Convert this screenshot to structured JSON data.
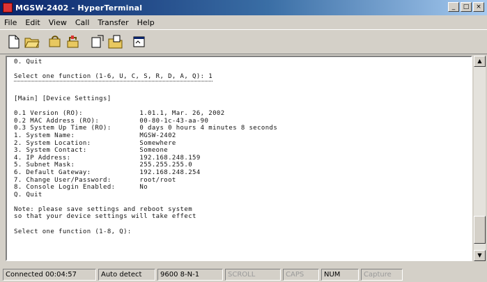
{
  "window": {
    "title": "MGSW-2402 - HyperTerminal"
  },
  "title_buttons": {
    "minimize": "_",
    "maximize": "□",
    "close": "×"
  },
  "menu": [
    "File",
    "Edit",
    "View",
    "Call",
    "Transfer",
    "Help"
  ],
  "toolbar": [
    "new-icon",
    "open-icon",
    "connect-icon",
    "disconnect-icon",
    "send-icon",
    "receive-icon",
    "properties-icon"
  ],
  "terminal": {
    "lines": [
      "0. Quit",
      "",
      "Select one function (1-6, U, C, S, R, D, A, Q): 1",
      "",
      "",
      "[Main] [Device Settings]",
      "",
      "0.1 Version (RO):              1.01.1, Mar. 26, 2002",
      "0.2 MAC Address (RO):          00-80-1c-43-aa-90",
      "0.3 System Up Time (RO):       0 days 0 hours 4 minutes 8 seconds",
      "1. System Name:                MGSW-2402",
      "2. System Location:            Somewhere",
      "3. System Contact:             Someone",
      "4. IP Address:                 192.168.248.159",
      "5. Subnet Mask:                255.255.255.0",
      "6. Default Gateway:            192.168.248.254",
      "7. Change User/Password:       root/root",
      "8. Console Login Enabled:      No",
      "Q. Quit",
      "",
      "Note: please save settings and reboot system",
      "so that your device settings will take effect",
      "",
      "Select one function (1-8, Q):"
    ]
  },
  "statusbar": {
    "connected": "Connected 00:04:57",
    "detect": "Auto detect",
    "port": "9600 8-N-1",
    "scroll": "SCROLL",
    "caps": "CAPS",
    "num": "NUM",
    "capture": "Capture"
  }
}
